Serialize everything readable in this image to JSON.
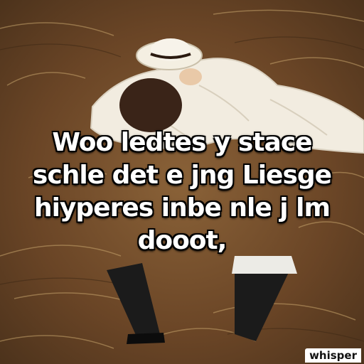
{
  "caption": {
    "lines": [
      "Woo ledtes y stace",
      "schle det e jng Liesge",
      "hiyperes inbe nle j lm",
      "dooot,"
    ]
  },
  "watermark": {
    "text": "whisper"
  },
  "colors": {
    "grass_dark": "#5a3d22",
    "grass_light": "#b8955e",
    "dress": "#f2ece0",
    "hat": "#f4efe2",
    "hair": "#3a2418",
    "boots": "#141414",
    "caption_text": "#ffffff"
  }
}
